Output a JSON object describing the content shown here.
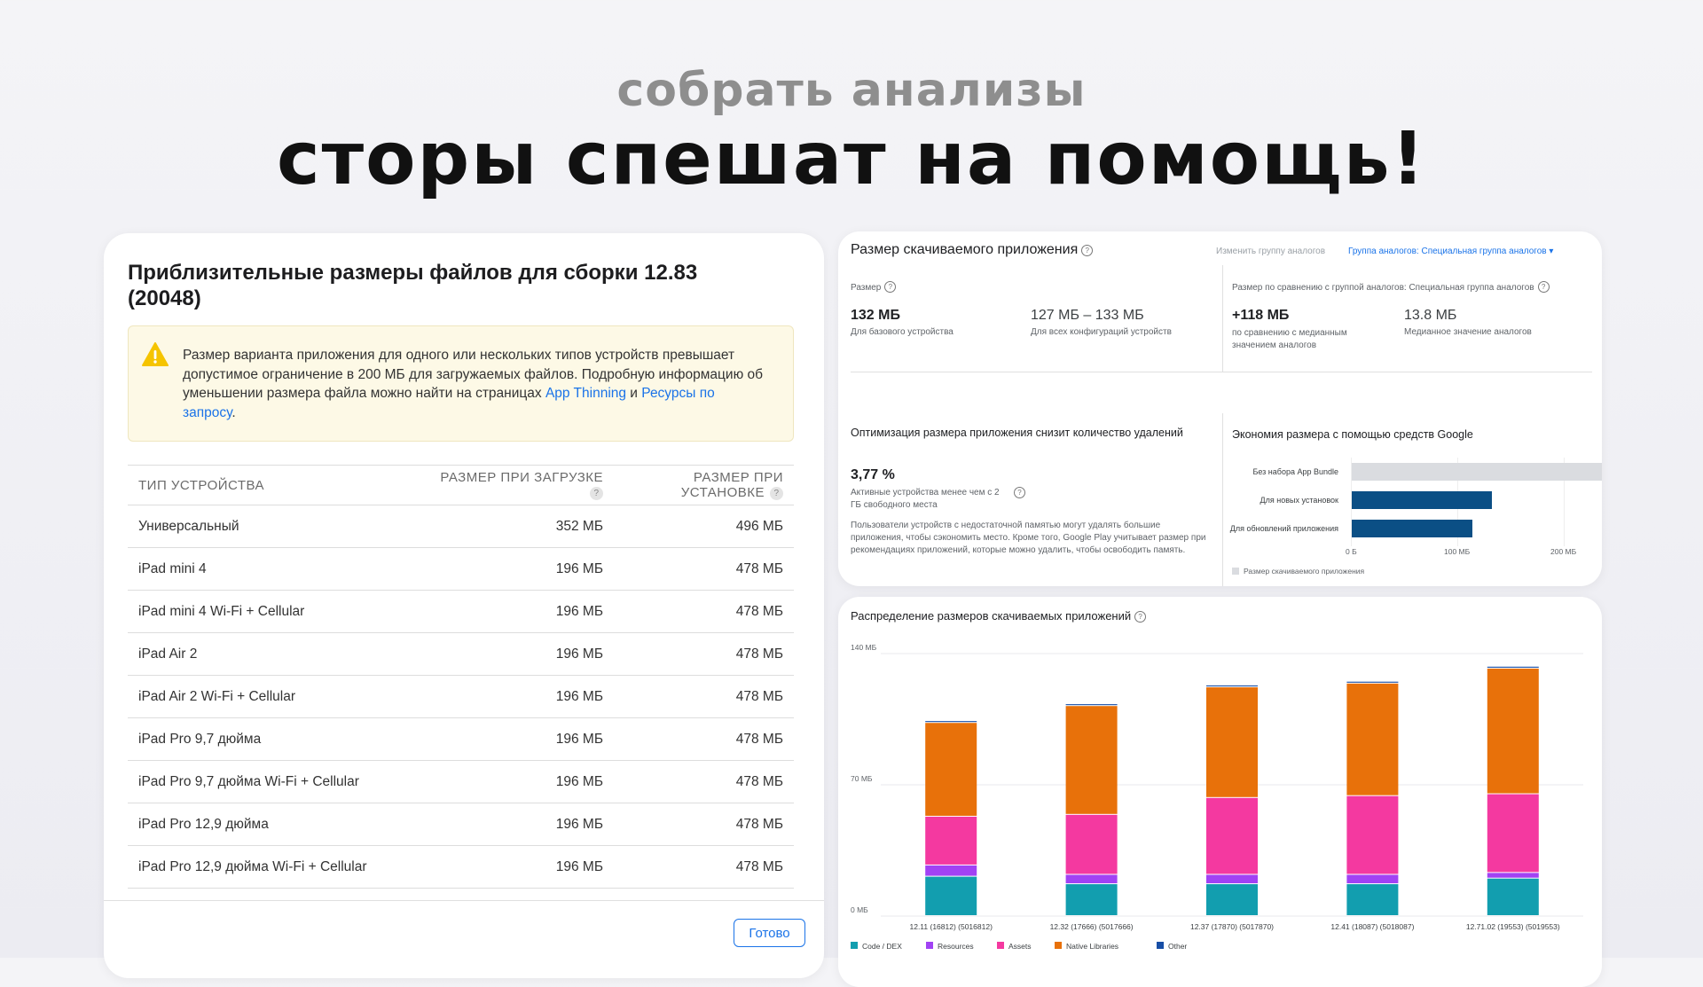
{
  "hero": {
    "subtitle": "собрать анализы",
    "title": "сторы спешат на помощь!"
  },
  "apple": {
    "title": "Приблизительные размеры файлов для сборки 12.83 (20048)",
    "warning": {
      "text_before": "Размер варианта приложения для одного или нескольких типов устройств превышает допустимое ограничение в 200 МБ для загружаемых файлов. Подробную информацию об уменьшении размера файла можно найти на страницах ",
      "link1": "App Thinning",
      "text_mid": " и ",
      "link2": "Ресурсы по запросу",
      "text_after": "."
    },
    "table": {
      "headers": [
        "ТИП УСТРОЙСТВА",
        "РАЗМЕР ПРИ ЗАГРУЗКЕ",
        "РАЗМЕР ПРИ УСТАНОВКЕ"
      ],
      "help_glyph": "?",
      "rows": [
        [
          "Универсальный",
          "352 МБ",
          "496 МБ"
        ],
        [
          "iPad mini 4",
          "196 МБ",
          "478 МБ"
        ],
        [
          "iPad mini 4 Wi-Fi + Cellular",
          "196 МБ",
          "478 МБ"
        ],
        [
          "iPad Air 2",
          "196 МБ",
          "478 МБ"
        ],
        [
          "iPad Air 2 Wi-Fi + Cellular",
          "196 МБ",
          "478 МБ"
        ],
        [
          "iPad Pro 9,7 дюйма",
          "196 МБ",
          "478 МБ"
        ],
        [
          "iPad Pro 9,7 дюйма Wi-Fi + Cellular",
          "196 МБ",
          "478 МБ"
        ],
        [
          "iPad Pro 12,9 дюйма",
          "196 МБ",
          "478 МБ"
        ],
        [
          "iPad Pro 12,9 дюйма Wi-Fi + Cellular",
          "196 МБ",
          "478 МБ"
        ]
      ]
    },
    "done_label": "Готово",
    "colors": {
      "link": "#1a73e8",
      "warning_bg": "#fdf9e6",
      "warning_icon": "#f5c400"
    }
  },
  "google": {
    "title": "Размер скачиваемого приложения",
    "change_group": "Изменить группу аналогов",
    "peer_group": "Группа аналогов: Специальная группа аналогов",
    "size_label": "Размер",
    "base_value": "132 МБ",
    "base_caption": "Для базового устройства",
    "all_value": "127 МБ – 133 МБ",
    "all_caption": "Для всех конфигураций устройств",
    "compare_label": "Размер по сравнению с группой аналогов: Специальная группа аналогов",
    "delta_value": "+118 МБ",
    "delta_caption": "по сравнению с медианным значением аналогов",
    "median_value": "13.8 МБ",
    "median_caption": "Медианное значение аналогов",
    "opt_title": "Оптимизация размера приложения снизит количество удалений",
    "opt_value": "3,77 %",
    "opt_caption": "Активные устройства менее чем с 2 ГБ свободного места",
    "opt_body": "Пользователи устройств с недостаточной памятью могут удалять большие приложения, чтобы сэкономить место. Кроме того, Google Play учитывает размер при рекомендациях приложений, которые можно удалить, чтобы освободить память.",
    "savings_title": "Экономия размера с помощью средств Google",
    "savings_chart": {
      "type": "bar",
      "categories": [
        "Без набора App Bundle",
        "Для новых установок",
        "Для обновлений приложения"
      ],
      "values": [
        245,
        132,
        113
      ],
      "xticks": [
        "0 Б",
        "100 МБ",
        "200 МБ"
      ],
      "xlim": [
        0,
        200
      ],
      "legend": "Размер скачиваемого приложения",
      "colors": [
        "#dadce0",
        "#0b4f85",
        "#0b4f85"
      ]
    }
  },
  "chart_data": {
    "type": "bar",
    "stacked": true,
    "title": "Распределение размеров скачиваемых приложений",
    "categories": [
      "12.11 (16812) (5016812)",
      "12.32 (17666) (5017666)",
      "12.37 (17870) (5017870)",
      "12.41 (18087) (5018087)",
      "12.71.02 (19553) (5019553)"
    ],
    "yticks": [
      "0 МБ",
      "70 МБ",
      "140 МБ"
    ],
    "ylim": [
      0,
      140
    ],
    "series": [
      {
        "name": "Code / DEX",
        "color": "#129eaf",
        "values": [
          21,
          17,
          17,
          17,
          20
        ]
      },
      {
        "name": "Resources",
        "color": "#a142f4",
        "values": [
          6,
          5,
          5,
          5,
          3
        ]
      },
      {
        "name": "Assets",
        "color": "#f439a0",
        "values": [
          26,
          32,
          41,
          42,
          42
        ]
      },
      {
        "name": "Native Libraries",
        "color": "#e8710a",
        "values": [
          50,
          58,
          59,
          60,
          67
        ]
      },
      {
        "name": "Other",
        "color": "#174ea6",
        "values": [
          1,
          1,
          1,
          1,
          1
        ]
      }
    ],
    "grid": true,
    "legend_position": "bottom"
  }
}
